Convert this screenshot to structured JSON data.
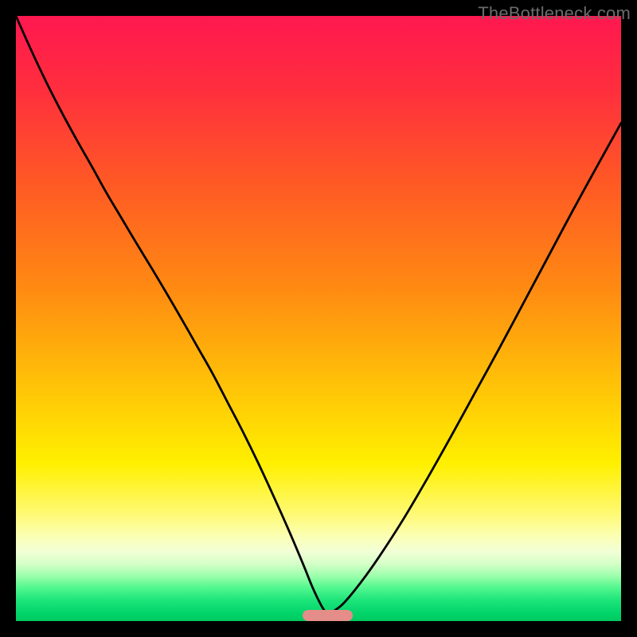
{
  "watermark": "TheBottleneck.com",
  "marker": {
    "x_fraction": 0.515,
    "width_fraction": 0.082,
    "color": "#e58d88"
  },
  "gradient_stops": [
    {
      "offset": 0.0,
      "color": "#ff1850"
    },
    {
      "offset": 0.12,
      "color": "#ff2e3e"
    },
    {
      "offset": 0.28,
      "color": "#ff5a24"
    },
    {
      "offset": 0.45,
      "color": "#ff8a12"
    },
    {
      "offset": 0.6,
      "color": "#ffbf08"
    },
    {
      "offset": 0.74,
      "color": "#fff000"
    },
    {
      "offset": 0.82,
      "color": "#fff970"
    },
    {
      "offset": 0.86,
      "color": "#fbffb4"
    },
    {
      "offset": 0.885,
      "color": "#f2ffd6"
    },
    {
      "offset": 0.905,
      "color": "#d6ffc8"
    },
    {
      "offset": 0.925,
      "color": "#9dffad"
    },
    {
      "offset": 0.945,
      "color": "#52f78f"
    },
    {
      "offset": 0.965,
      "color": "#1ee57a"
    },
    {
      "offset": 0.988,
      "color": "#00d46a"
    },
    {
      "offset": 1.0,
      "color": "#00c95f"
    }
  ],
  "chart_data": {
    "type": "line",
    "title": "",
    "xlabel": "",
    "ylabel": "",
    "xlim": [
      0,
      1
    ],
    "ylim": [
      0,
      1
    ],
    "categories": [],
    "series": [
      {
        "name": "left-branch",
        "x": [
          0.0,
          0.025,
          0.05,
          0.075,
          0.1,
          0.125,
          0.15,
          0.175,
          0.2,
          0.225,
          0.25,
          0.275,
          0.3,
          0.325,
          0.35,
          0.375,
          0.4,
          0.425,
          0.45,
          0.475,
          0.49,
          0.505,
          0.515
        ],
        "y": [
          1.0,
          0.944,
          0.891,
          0.842,
          0.796,
          0.752,
          0.707,
          0.665,
          0.623,
          0.582,
          0.54,
          0.497,
          0.453,
          0.409,
          0.361,
          0.313,
          0.262,
          0.208,
          0.152,
          0.093,
          0.056,
          0.025,
          0.01
        ]
      },
      {
        "name": "right-branch",
        "x": [
          0.515,
          0.54,
          0.57,
          0.6,
          0.64,
          0.68,
          0.72,
          0.76,
          0.8,
          0.84,
          0.88,
          0.92,
          0.96,
          1.0
        ],
        "y": [
          0.01,
          0.028,
          0.064,
          0.106,
          0.168,
          0.236,
          0.307,
          0.38,
          0.453,
          0.528,
          0.603,
          0.678,
          0.751,
          0.823
        ]
      }
    ],
    "annotations": [
      {
        "name": "minimum-marker",
        "x": 0.515,
        "y": 0.01
      }
    ]
  }
}
